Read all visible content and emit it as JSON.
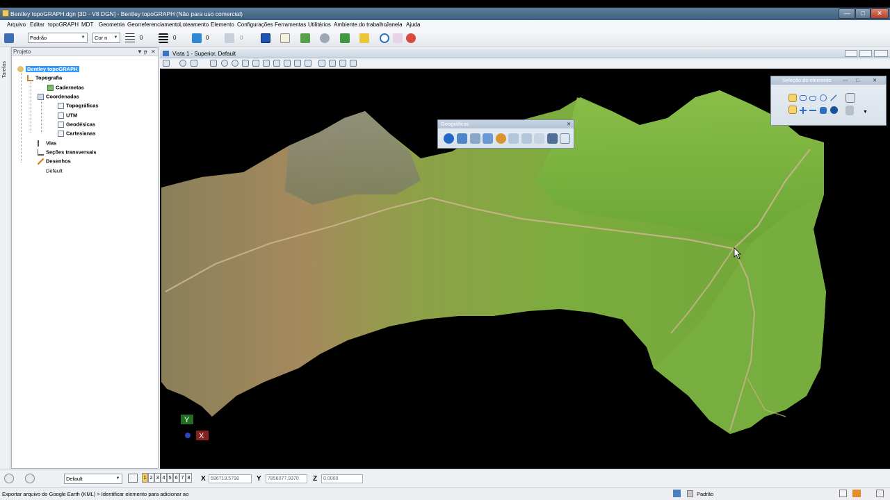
{
  "window": {
    "title": "Bentley topoGRAPH.dgn [3D - V8 DGN] - Bentley topoGRAPH (Não para uso comercial)",
    "min": "—",
    "max": "□",
    "close": "✕"
  },
  "menu": [
    "Arquivo",
    "Editar",
    "topoGRAPH",
    "MDT",
    "Geometria",
    "Georreferenciamento",
    "Loteamento",
    "Elemento",
    "Configurações",
    "Ferramentas",
    "Utilitários",
    "Ambiente do trabalho",
    "Janela",
    "Ajuda"
  ],
  "toolbar": {
    "level": "Padrão",
    "color": "Cor n",
    "style": "0",
    "weight": "0",
    "transparency": "0",
    "priority": "0"
  },
  "tasks_tab": "Tarefas",
  "project": {
    "title": "Projeto",
    "pin": "ᵽ",
    "close": "✕",
    "tree": [
      {
        "label": "Bentley topoGRAPH",
        "icon": "project-icon"
      },
      {
        "label": "Topografia",
        "icon": "survey-icon"
      },
      {
        "label": "Cadernetas",
        "icon": "notebook-icon"
      },
      {
        "label": "Coordenadas",
        "icon": "coordinates-icon"
      },
      {
        "label": "Topográficas",
        "icon": "grid-icon"
      },
      {
        "label": "UTM",
        "icon": "grid-icon"
      },
      {
        "label": "Geodésicas",
        "icon": "grid-icon"
      },
      {
        "label": "Cartesianas",
        "icon": "grid-icon"
      },
      {
        "label": "Vias",
        "icon": "road-icon"
      },
      {
        "label": "Seções transversais",
        "icon": "section-icon"
      },
      {
        "label": "Desenhos",
        "icon": "drawing-icon"
      },
      {
        "label": "Default",
        "icon": ""
      }
    ]
  },
  "view": {
    "title": "Vista 1 - Superior, Default",
    "axis_y": "Y",
    "axis_x": "X"
  },
  "geo_toolbox": {
    "title": "Geográficos",
    "close": "✕"
  },
  "selection_panel": {
    "title": "Seleção do elemento",
    "min": "—",
    "max": "□",
    "close": "✕"
  },
  "status": {
    "view_group": "Default",
    "views": [
      "1",
      "2",
      "3",
      "4",
      "5",
      "6",
      "7",
      "8"
    ],
    "x_label": "X",
    "x_value": "596719.5798",
    "y_label": "Y",
    "y_value": "7856077.9370",
    "z_label": "Z",
    "z_value": "0.0000",
    "message": "Exportar arquivo do Google Earth (KML) > Identificar elemento para adicionar ao",
    "level": "Padrão"
  },
  "colors": {
    "title_bar": "#3d5f7f",
    "terrain_green": "#6fa638",
    "terrain_brown": "#a58a5c",
    "selection": "#3399ff"
  }
}
